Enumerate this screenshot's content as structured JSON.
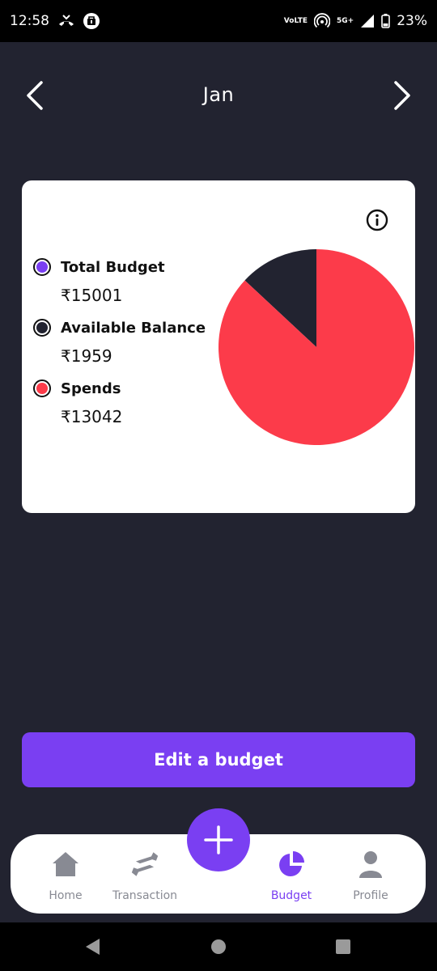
{
  "status_bar": {
    "time": "12:58",
    "volte_top": "Vo",
    "volte_bottom": "LTE",
    "network": "5G+",
    "battery": "23%"
  },
  "header": {
    "month": "Jan",
    "prev_icon": "chevron-left-icon",
    "next_icon": "chevron-right-icon"
  },
  "budget_card": {
    "info_icon": "info-icon",
    "legend": [
      {
        "label": "Total Budget",
        "value": "₹15001",
        "color": "#7a3ff2"
      },
      {
        "label": "Available Balance",
        "value": "₹1959",
        "color": "#222330"
      },
      {
        "label": "Spends",
        "value": "₹13042",
        "color": "#fc3b4a"
      }
    ]
  },
  "chart_data": {
    "type": "pie",
    "slices": [
      {
        "label": "Available Balance",
        "value": 1959,
        "color": "#222330"
      },
      {
        "label": "Spends",
        "value": 13042,
        "color": "#fc3b4a"
      }
    ]
  },
  "actions": {
    "edit_budget": "Edit a budget"
  },
  "bottom_nav": {
    "items": [
      {
        "label": "Home",
        "icon": "home-icon"
      },
      {
        "label": "Transaction",
        "icon": "transaction-icon"
      },
      {
        "label": "Budget",
        "icon": "budget-pie-icon",
        "active": true
      },
      {
        "label": "Profile",
        "icon": "profile-icon"
      }
    ],
    "fab_icon": "plus-icon"
  },
  "colors": {
    "background": "#222330",
    "accent": "#7a3ff2",
    "spend": "#fc3b4a",
    "inactive": "#888a93"
  }
}
